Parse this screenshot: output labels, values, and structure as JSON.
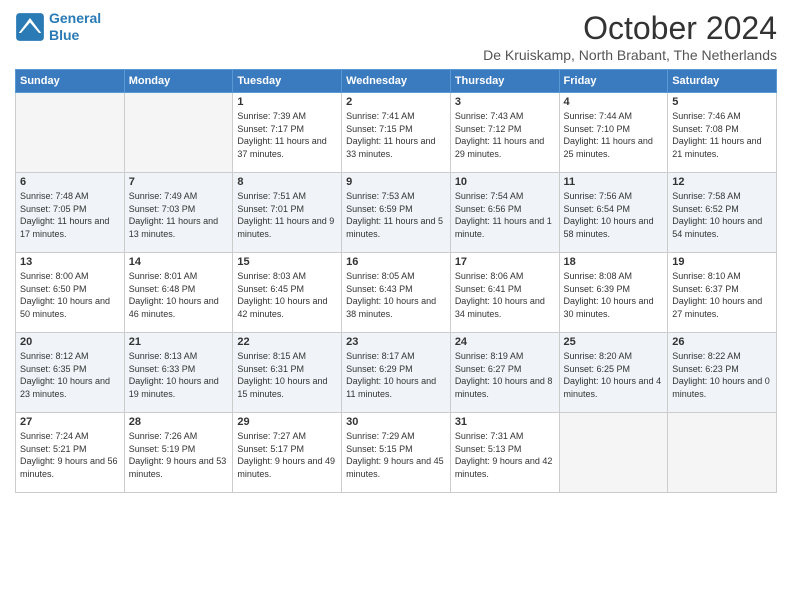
{
  "header": {
    "logo_line1": "General",
    "logo_line2": "Blue",
    "title": "October 2024",
    "subtitle": "De Kruiskamp, North Brabant, The Netherlands"
  },
  "days_of_week": [
    "Sunday",
    "Monday",
    "Tuesday",
    "Wednesday",
    "Thursday",
    "Friday",
    "Saturday"
  ],
  "weeks": [
    {
      "alt": false,
      "days": [
        {
          "num": "",
          "info": ""
        },
        {
          "num": "",
          "info": ""
        },
        {
          "num": "1",
          "info": "Sunrise: 7:39 AM\nSunset: 7:17 PM\nDaylight: 11 hours and 37 minutes."
        },
        {
          "num": "2",
          "info": "Sunrise: 7:41 AM\nSunset: 7:15 PM\nDaylight: 11 hours and 33 minutes."
        },
        {
          "num": "3",
          "info": "Sunrise: 7:43 AM\nSunset: 7:12 PM\nDaylight: 11 hours and 29 minutes."
        },
        {
          "num": "4",
          "info": "Sunrise: 7:44 AM\nSunset: 7:10 PM\nDaylight: 11 hours and 25 minutes."
        },
        {
          "num": "5",
          "info": "Sunrise: 7:46 AM\nSunset: 7:08 PM\nDaylight: 11 hours and 21 minutes."
        }
      ]
    },
    {
      "alt": true,
      "days": [
        {
          "num": "6",
          "info": "Sunrise: 7:48 AM\nSunset: 7:05 PM\nDaylight: 11 hours and 17 minutes."
        },
        {
          "num": "7",
          "info": "Sunrise: 7:49 AM\nSunset: 7:03 PM\nDaylight: 11 hours and 13 minutes."
        },
        {
          "num": "8",
          "info": "Sunrise: 7:51 AM\nSunset: 7:01 PM\nDaylight: 11 hours and 9 minutes."
        },
        {
          "num": "9",
          "info": "Sunrise: 7:53 AM\nSunset: 6:59 PM\nDaylight: 11 hours and 5 minutes."
        },
        {
          "num": "10",
          "info": "Sunrise: 7:54 AM\nSunset: 6:56 PM\nDaylight: 11 hours and 1 minute."
        },
        {
          "num": "11",
          "info": "Sunrise: 7:56 AM\nSunset: 6:54 PM\nDaylight: 10 hours and 58 minutes."
        },
        {
          "num": "12",
          "info": "Sunrise: 7:58 AM\nSunset: 6:52 PM\nDaylight: 10 hours and 54 minutes."
        }
      ]
    },
    {
      "alt": false,
      "days": [
        {
          "num": "13",
          "info": "Sunrise: 8:00 AM\nSunset: 6:50 PM\nDaylight: 10 hours and 50 minutes."
        },
        {
          "num": "14",
          "info": "Sunrise: 8:01 AM\nSunset: 6:48 PM\nDaylight: 10 hours and 46 minutes."
        },
        {
          "num": "15",
          "info": "Sunrise: 8:03 AM\nSunset: 6:45 PM\nDaylight: 10 hours and 42 minutes."
        },
        {
          "num": "16",
          "info": "Sunrise: 8:05 AM\nSunset: 6:43 PM\nDaylight: 10 hours and 38 minutes."
        },
        {
          "num": "17",
          "info": "Sunrise: 8:06 AM\nSunset: 6:41 PM\nDaylight: 10 hours and 34 minutes."
        },
        {
          "num": "18",
          "info": "Sunrise: 8:08 AM\nSunset: 6:39 PM\nDaylight: 10 hours and 30 minutes."
        },
        {
          "num": "19",
          "info": "Sunrise: 8:10 AM\nSunset: 6:37 PM\nDaylight: 10 hours and 27 minutes."
        }
      ]
    },
    {
      "alt": true,
      "days": [
        {
          "num": "20",
          "info": "Sunrise: 8:12 AM\nSunset: 6:35 PM\nDaylight: 10 hours and 23 minutes."
        },
        {
          "num": "21",
          "info": "Sunrise: 8:13 AM\nSunset: 6:33 PM\nDaylight: 10 hours and 19 minutes."
        },
        {
          "num": "22",
          "info": "Sunrise: 8:15 AM\nSunset: 6:31 PM\nDaylight: 10 hours and 15 minutes."
        },
        {
          "num": "23",
          "info": "Sunrise: 8:17 AM\nSunset: 6:29 PM\nDaylight: 10 hours and 11 minutes."
        },
        {
          "num": "24",
          "info": "Sunrise: 8:19 AM\nSunset: 6:27 PM\nDaylight: 10 hours and 8 minutes."
        },
        {
          "num": "25",
          "info": "Sunrise: 8:20 AM\nSunset: 6:25 PM\nDaylight: 10 hours and 4 minutes."
        },
        {
          "num": "26",
          "info": "Sunrise: 8:22 AM\nSunset: 6:23 PM\nDaylight: 10 hours and 0 minutes."
        }
      ]
    },
    {
      "alt": false,
      "days": [
        {
          "num": "27",
          "info": "Sunrise: 7:24 AM\nSunset: 5:21 PM\nDaylight: 9 hours and 56 minutes."
        },
        {
          "num": "28",
          "info": "Sunrise: 7:26 AM\nSunset: 5:19 PM\nDaylight: 9 hours and 53 minutes."
        },
        {
          "num": "29",
          "info": "Sunrise: 7:27 AM\nSunset: 5:17 PM\nDaylight: 9 hours and 49 minutes."
        },
        {
          "num": "30",
          "info": "Sunrise: 7:29 AM\nSunset: 5:15 PM\nDaylight: 9 hours and 45 minutes."
        },
        {
          "num": "31",
          "info": "Sunrise: 7:31 AM\nSunset: 5:13 PM\nDaylight: 9 hours and 42 minutes."
        },
        {
          "num": "",
          "info": ""
        },
        {
          "num": "",
          "info": ""
        }
      ]
    }
  ]
}
